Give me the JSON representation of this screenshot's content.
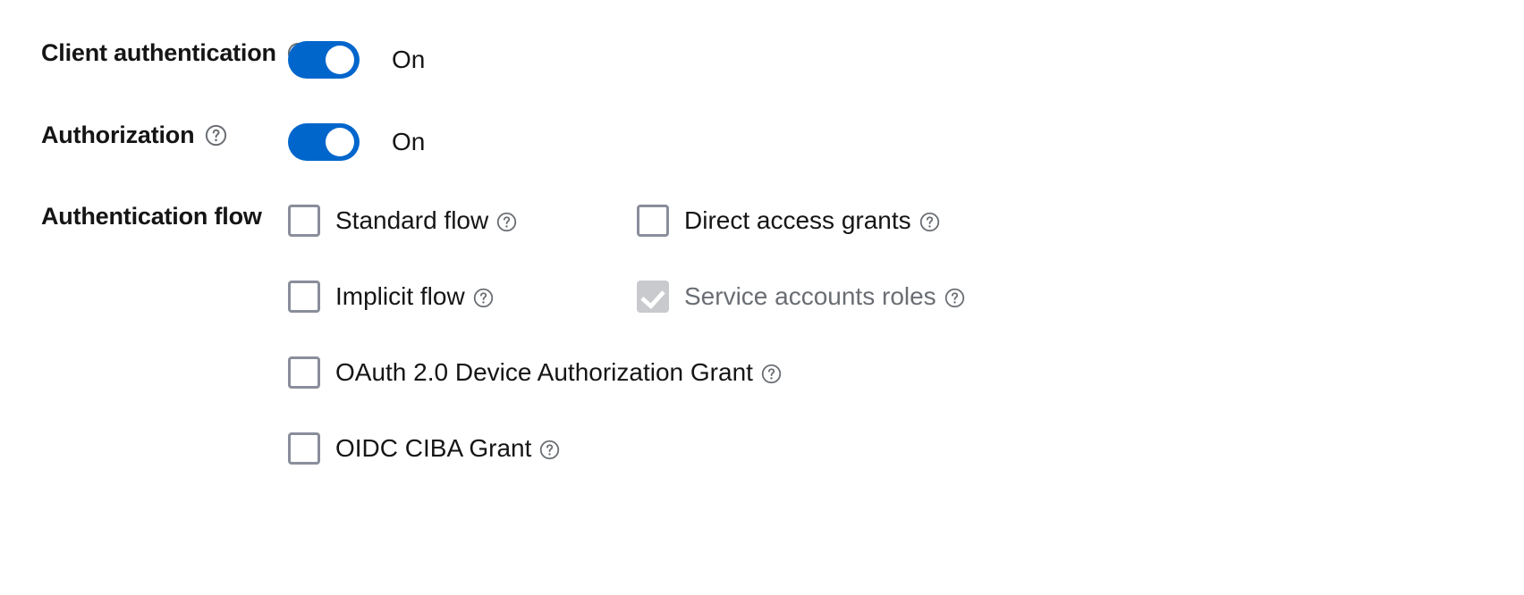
{
  "form": {
    "rows": [
      {
        "key": "client_authentication",
        "label": "Client authentication",
        "help_icon": "help-circle-icon",
        "toggle": {
          "state": "on",
          "state_label": "On"
        }
      },
      {
        "key": "authorization",
        "label": "Authorization",
        "help_icon": "help-circle-icon",
        "toggle": {
          "state": "on",
          "state_label": "On"
        }
      },
      {
        "key": "authentication_flow",
        "label": "Authentication flow",
        "help_icon": null
      }
    ]
  },
  "authentication_flow": {
    "label": "Authentication flow",
    "checkboxes": [
      {
        "id": "standard-flow",
        "label": "Standard flow",
        "checked": false,
        "disabled": false,
        "help_icon": "help-circle-icon"
      },
      {
        "id": "direct-access-grants",
        "label": "Direct access grants",
        "checked": false,
        "disabled": false,
        "help_icon": "help-circle-icon"
      },
      {
        "id": "implicit-flow",
        "label": "Implicit flow",
        "checked": false,
        "disabled": false,
        "help_icon": "help-circle-icon"
      },
      {
        "id": "service-accounts-roles",
        "label": "Service accounts roles",
        "checked": true,
        "disabled": true,
        "help_icon": "help-circle-icon"
      },
      {
        "id": "oauth-device-authorization-grant",
        "label": "OAuth 2.0 Device Authorization Grant",
        "checked": false,
        "disabled": false,
        "help_icon": "help-circle-icon"
      },
      {
        "id": "oidc-ciba-grant",
        "label": "OIDC CIBA Grant",
        "checked": false,
        "disabled": false,
        "help_icon": "help-circle-icon"
      }
    ]
  },
  "colors": {
    "toggle_on": "#0066CC",
    "checkbox_border": "#8A8D9B",
    "checkbox_disabled_fill": "#C8CACD",
    "text_primary": "#151515",
    "text_disabled": "#6A6E73",
    "help_icon": "#6A6E73",
    "background": "#FFFFFF"
  }
}
